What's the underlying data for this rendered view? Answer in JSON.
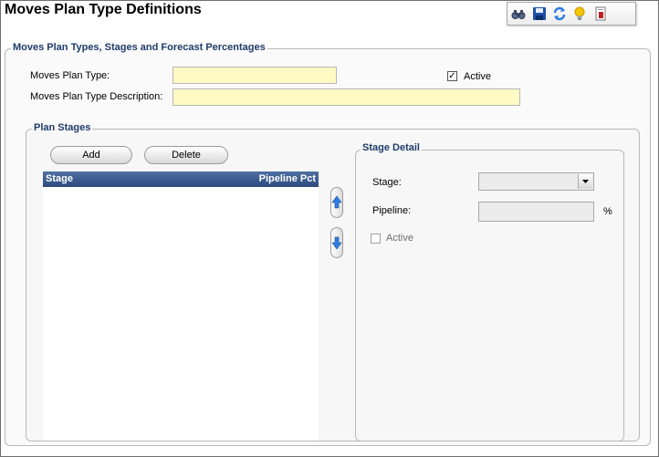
{
  "header": {
    "title": "Moves Plan Type Definitions"
  },
  "toolbar": {
    "icons": [
      "binoculars-icon",
      "save-icon",
      "refresh-icon",
      "lightbulb-icon",
      "report-icon"
    ],
    "colors": {
      "save": "#1f4fa8",
      "refresh": "#2f7de0",
      "lightbulb": "#f5c400",
      "report": "#c02020"
    }
  },
  "main_group": {
    "legend": "Moves Plan Types, Stages and Forecast Percentages",
    "plan_type_label": "Moves Plan Type:",
    "plan_type_value": "",
    "description_label": "Moves Plan Type Description:",
    "description_value": "",
    "active_label": "Active",
    "active_checked": true
  },
  "plan_stages": {
    "legend": "Plan Stages",
    "add_label": "Add",
    "delete_label": "Delete",
    "columns": [
      "Stage",
      "Pipeline Pct"
    ],
    "rows": []
  },
  "stage_detail": {
    "legend": "Stage Detail",
    "stage_label": "Stage:",
    "stage_value": "",
    "pipeline_label": "Pipeline:",
    "pipeline_value": "",
    "pipeline_unit": "%",
    "active_label": "Active",
    "active_checked": false
  },
  "colors": {
    "legend_text": "#1f3d6b",
    "input_highlight": "#fff9c4",
    "grid_header": "#2c4a7d"
  }
}
